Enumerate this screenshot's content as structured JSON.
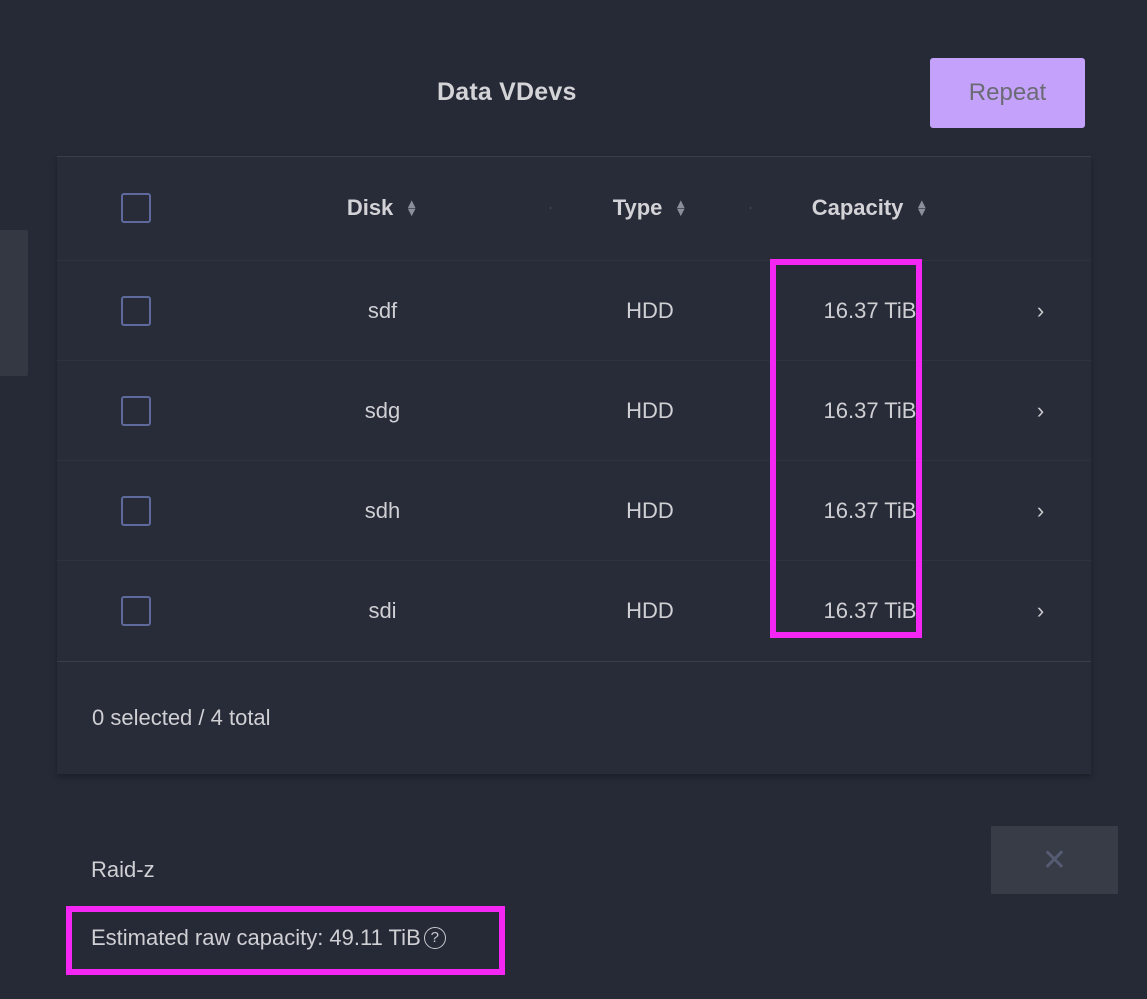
{
  "header": {
    "title": "Data VDevs",
    "repeat_label": "Repeat"
  },
  "table": {
    "columns": [
      {
        "key": "checkbox",
        "label": ""
      },
      {
        "key": "disk",
        "label": "Disk",
        "sortable": true
      },
      {
        "key": "type",
        "label": "Type",
        "sortable": true
      },
      {
        "key": "capacity",
        "label": "Capacity",
        "sortable": true
      },
      {
        "key": "expand",
        "label": ""
      }
    ],
    "sort_icon": "sort-updown-icon",
    "rows": [
      {
        "disk": "sdf",
        "type": "HDD",
        "capacity": "16.37 TiB",
        "expand_icon": "chevron-right-icon",
        "checked": false
      },
      {
        "disk": "sdg",
        "type": "HDD",
        "capacity": "16.37 TiB",
        "expand_icon": "chevron-right-icon",
        "checked": false
      },
      {
        "disk": "sdh",
        "type": "HDD",
        "capacity": "16.37 TiB",
        "expand_icon": "chevron-right-icon",
        "checked": false
      },
      {
        "disk": "sdi",
        "type": "HDD",
        "capacity": "16.37 TiB",
        "expand_icon": "chevron-right-icon",
        "checked": false
      }
    ],
    "footer_status": "0 selected / 4 total"
  },
  "layout": {
    "raidz_label": "Raid-z",
    "close_label": "✕",
    "close_icon": "close-x-icon",
    "estimated_capacity": "Estimated raw capacity: 49.11 TiB",
    "help_icon": "help-circle-icon",
    "help_glyph": "?"
  },
  "colors": {
    "background": "#262a36",
    "card": "#282c38",
    "accent_button": "#c4a2fb",
    "highlight": "#f326f3",
    "checkbox_border": "#5d6a9b",
    "text": "#cfcfd4"
  }
}
